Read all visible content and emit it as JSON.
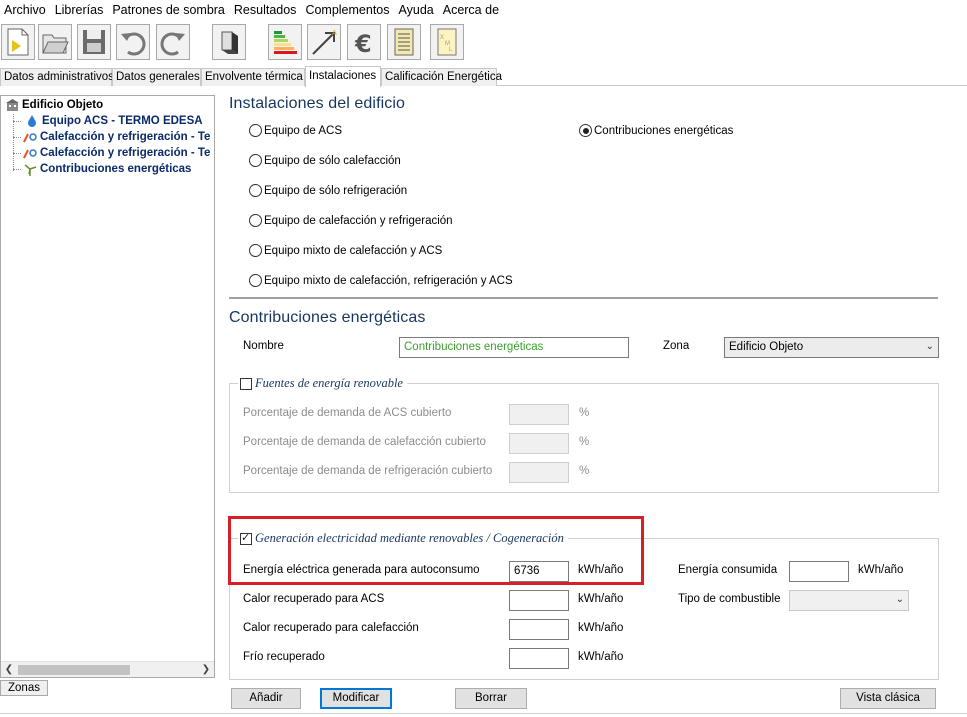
{
  "menu": [
    "Archivo",
    "Librerías",
    "Patrones de sombra",
    "Resultados",
    "Complementos",
    "Ayuda",
    "Acerca de"
  ],
  "tabs": [
    {
      "label": "Datos administrativos",
      "active": false
    },
    {
      "label": "Datos generales",
      "active": false
    },
    {
      "label": "Envolvente térmica",
      "active": false
    },
    {
      "label": "Instalaciones",
      "active": true
    },
    {
      "label": "Calificación Energética",
      "active": false
    }
  ],
  "tree": {
    "root": "Edificio Objeto",
    "items": [
      {
        "label": "Equipo ACS - TERMO EDESA",
        "icon": "water-drop-icon"
      },
      {
        "label": "Calefacción y refrigeración - Te",
        "icon": "heat-cool-icon"
      },
      {
        "label": "Calefacción y refrigeración - Te",
        "icon": "heat-cool-icon"
      },
      {
        "label": "Contribuciones energéticas",
        "icon": "wind-turbine-icon"
      }
    ],
    "zonas_button": "Zonas"
  },
  "instalaciones": {
    "title": "Instalaciones del edificio",
    "options": [
      {
        "label": "Equipo de ACS",
        "checked": false
      },
      {
        "label": "Equipo de sólo calefacción",
        "checked": false
      },
      {
        "label": "Equipo de sólo refrigeración",
        "checked": false
      },
      {
        "label": "Equipo de calefacción y refrigeración",
        "checked": false
      },
      {
        "label": "Equipo mixto de calefacción y ACS",
        "checked": false
      },
      {
        "label": "Equipo mixto de calefacción, refrigeración y ACS",
        "checked": false
      },
      {
        "label": "Contribuciones energéticas",
        "checked": true
      }
    ]
  },
  "contribuciones": {
    "title": "Contribuciones energéticas",
    "nombre_label": "Nombre",
    "nombre_value": "Contribuciones energéticas",
    "zona_label": "Zona",
    "zona_value": "Edificio Objeto"
  },
  "renovable": {
    "legend": "Fuentes de energía renovable",
    "checked": false,
    "rows": [
      {
        "label": "Porcentaje de demanda de ACS cubierto",
        "unit": "%",
        "value": ""
      },
      {
        "label": "Porcentaje de demanda de calefacción cubierto",
        "unit": "%",
        "value": ""
      },
      {
        "label": "Porcentaje de demanda de refrigeración cubierto",
        "unit": "%",
        "value": ""
      }
    ]
  },
  "cogeneracion": {
    "legend": "Generación electricidad mediante renovables / Cogeneración",
    "checked": true,
    "rows": [
      {
        "label": "Energía eléctrica generada para autoconsumo",
        "value": "6736",
        "unit": "kWh/año"
      },
      {
        "label": "Calor recuperado para ACS",
        "value": "",
        "unit": "kWh/año"
      },
      {
        "label": "Calor recuperado para calefacción",
        "value": "",
        "unit": "kWh/año"
      },
      {
        "label": "Frío recuperado",
        "value": "",
        "unit": "kWh/año"
      }
    ],
    "energia_consumida_label": "Energía consumida",
    "energia_consumida_value": "",
    "energia_consumida_unit": "kWh/año",
    "tipo_combustible_label": "Tipo de combustible",
    "tipo_combustible_value": ""
  },
  "buttons": {
    "add": "Añadir",
    "modify": "Modificar",
    "delete": "Borrar",
    "classic_view": "Vista clásica"
  },
  "colors": {
    "section_title": "#17365d",
    "tree_text": "#0a2a6b",
    "highlight": "#d81f26",
    "nombre_text": "#3aa02e"
  }
}
